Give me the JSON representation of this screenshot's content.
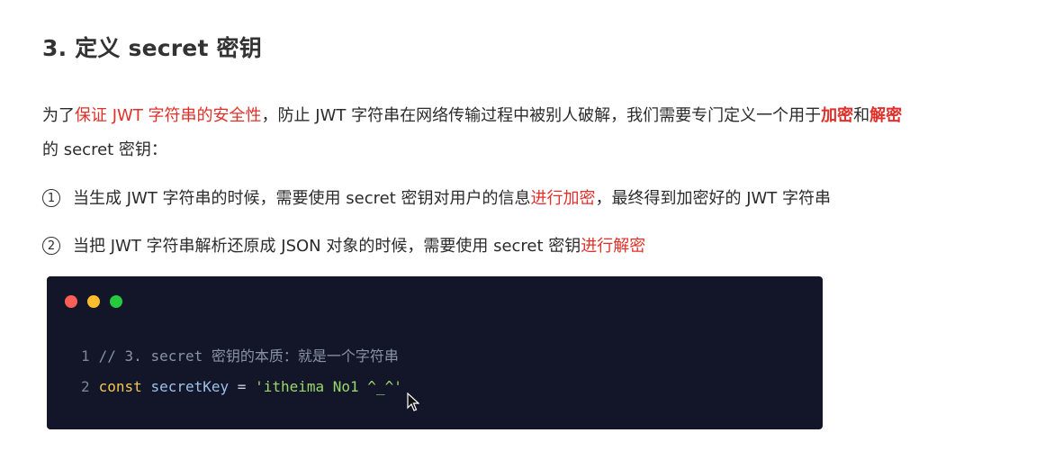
{
  "heading": "3. 定义 secret 密钥",
  "intro": {
    "part1": "为了",
    "part2_red": "保证 JWT 字符串的安全性",
    "part3": "，防止 JWT 字符串在网络传输过程中被别人破解，我们需要专门定义一个用于",
    "part4_red_bold": "加密",
    "part5": "和",
    "part6_red_bold": "解密",
    "line2": "的 secret 密钥："
  },
  "items": [
    {
      "marker": "1",
      "text_before": "当生成 JWT 字符串的时候，需要使用 secret 密钥对用户的信息",
      "text_red": "进行加密",
      "text_after": "，最终得到加密好的 JWT 字符串"
    },
    {
      "marker": "2",
      "text_before": "当把 JWT 字符串解析还原成 JSON 对象的时候，需要使用 secret 密钥",
      "text_red": "进行解密",
      "text_after": ""
    }
  ],
  "code": {
    "lines": [
      {
        "num": "1",
        "comment": "// 3. secret 密钥的本质：就是一个字符串"
      },
      {
        "num": "2",
        "keyword": "const",
        "variable": "secretKey",
        "operator": "=",
        "string": "'itheima No1 ^_^'"
      }
    ]
  },
  "colors": {
    "accent_red": "#e0302a",
    "code_bg": "#131629",
    "dot_red": "#ff5f56",
    "dot_yellow": "#ffbd2e",
    "dot_green": "#27c93f"
  }
}
